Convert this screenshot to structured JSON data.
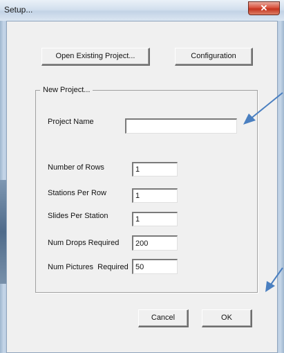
{
  "window": {
    "title": "Setup...",
    "close_glyph": "✕"
  },
  "top_buttons": {
    "open_existing": "Open Existing Project...",
    "configuration": "Configuration"
  },
  "group": {
    "title": "New Project...",
    "project_name_label": "Project Name",
    "project_name_value": ""
  },
  "fields": [
    {
      "label": "Number of Rows",
      "value": "1"
    },
    {
      "label": "Stations Per Row",
      "value": "1"
    },
    {
      "label": "Slides Per Station",
      "value": "1"
    },
    {
      "label": "Num Drops Required",
      "value": "200"
    },
    {
      "label": "Num Pictures  Required",
      "value": "50"
    }
  ],
  "bottom_buttons": {
    "cancel": "Cancel",
    "ok": "OK"
  },
  "annotation_arrows": {
    "color": "#4a7fc0",
    "icons": [
      "arrow-icon",
      "arrow-icon"
    ]
  }
}
